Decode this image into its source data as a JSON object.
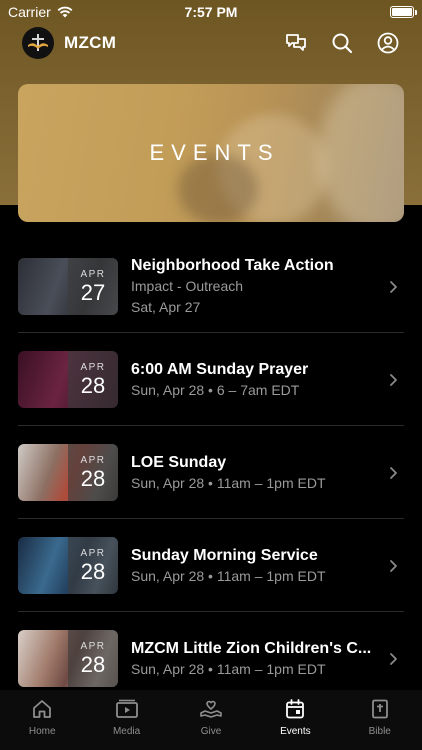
{
  "status_bar": {
    "carrier": "Carrier",
    "time": "7:57 PM"
  },
  "header": {
    "brand_name": "MZCM"
  },
  "banner": {
    "title": "EVENTS"
  },
  "events": [
    {
      "title": "Neighborhood Take Action",
      "line1": "Impact - Outreach",
      "line2": "Sat, Apr 27",
      "month": "APR",
      "day": "27",
      "thumb_color": "#3a3f48"
    },
    {
      "title": "6:00 AM Sunday Prayer",
      "line1": "Sun, Apr 28 • 6 – 7am EDT",
      "line2": "",
      "month": "APR",
      "day": "28",
      "thumb_color": "#5a1f3a"
    },
    {
      "title": "LOE Sunday",
      "line1": "Sun, Apr 28 • 11am – 1pm EDT",
      "line2": "",
      "month": "APR",
      "day": "28",
      "thumb_color": "#6b5a4e"
    },
    {
      "title": "Sunday Morning Service",
      "line1": "Sun, Apr 28 • 11am – 1pm EDT",
      "line2": "",
      "month": "APR",
      "day": "28",
      "thumb_color": "#2a4a6a"
    },
    {
      "title": "MZCM Little Zion Children's C...",
      "line1": "Sun, Apr 28 • 11am – 1pm EDT",
      "line2": "",
      "month": "APR",
      "day": "28",
      "thumb_color": "#7a6a62"
    }
  ],
  "tabs": [
    {
      "label": "Home",
      "icon": "home-icon"
    },
    {
      "label": "Media",
      "icon": "media-icon"
    },
    {
      "label": "Give",
      "icon": "give-icon"
    },
    {
      "label": "Events",
      "icon": "events-icon",
      "active": true
    },
    {
      "label": "Bible",
      "icon": "bible-icon"
    }
  ],
  "colors": {
    "accent": "#8a6f3a",
    "background": "#000000",
    "subtext": "#9a9a9a"
  }
}
